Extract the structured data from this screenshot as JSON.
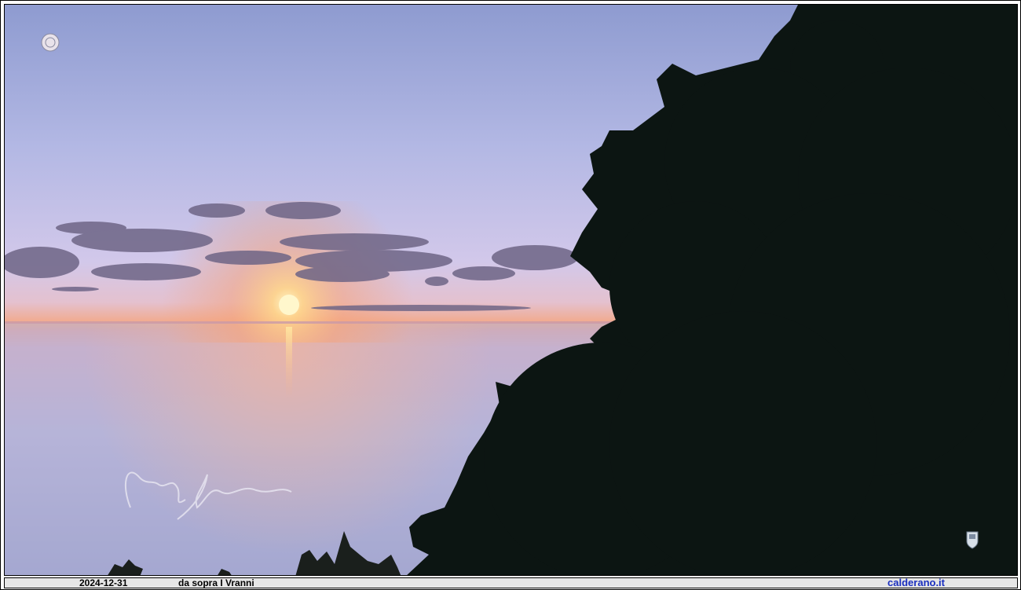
{
  "photo": {
    "date": "2024-12-31",
    "place": "da sopra I Vranni",
    "site": "calderano.it",
    "subject": "sunset-over-sea",
    "colors": {
      "sky_top": "#8f9ccf",
      "sky_mid": "#c9c3e6",
      "horizon_glow": "#f3a07a",
      "sea": "#b8b6d8",
      "tree": "#0b1411",
      "sun": "#fff3c0"
    }
  }
}
